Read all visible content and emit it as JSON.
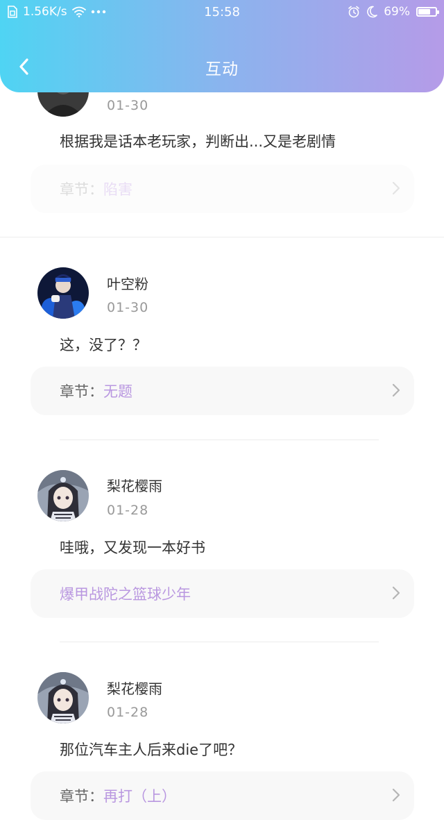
{
  "status_bar": {
    "network_speed": "1.56K/s",
    "time": "15:58",
    "battery_percent": "69%",
    "battery_level": 0.69,
    "icons": [
      "sim-icon",
      "wifi-icon",
      "more-dots-icon",
      "alarm-icon",
      "moon-icon",
      "battery-icon"
    ]
  },
  "header": {
    "title": "互动",
    "back_icon": "chevron-left-icon",
    "gradient": [
      "#4fd4f3",
      "#b59be8"
    ]
  },
  "accent_color": "#b997e0",
  "comments": [
    {
      "date": "01-30",
      "text": "根据我是话本老玩家，判断出...又是老剧情",
      "ref_prefix": "章节：",
      "ref_value": "陷害"
    },
    {
      "user": "叶空粉",
      "date": "01-30",
      "text": "这，没了？？",
      "ref_prefix": "章节：",
      "ref_value": "无题"
    },
    {
      "user": "梨花樱雨",
      "date": "01-28",
      "text": "哇哦，又发现一本好书",
      "ref_value": "爆甲战陀之篮球少年"
    },
    {
      "user": "梨花樱雨",
      "date": "01-28",
      "text": "那位汽车主人后来die了吧？",
      "ref_prefix": "章节：",
      "ref_value": "再打（上）"
    }
  ]
}
